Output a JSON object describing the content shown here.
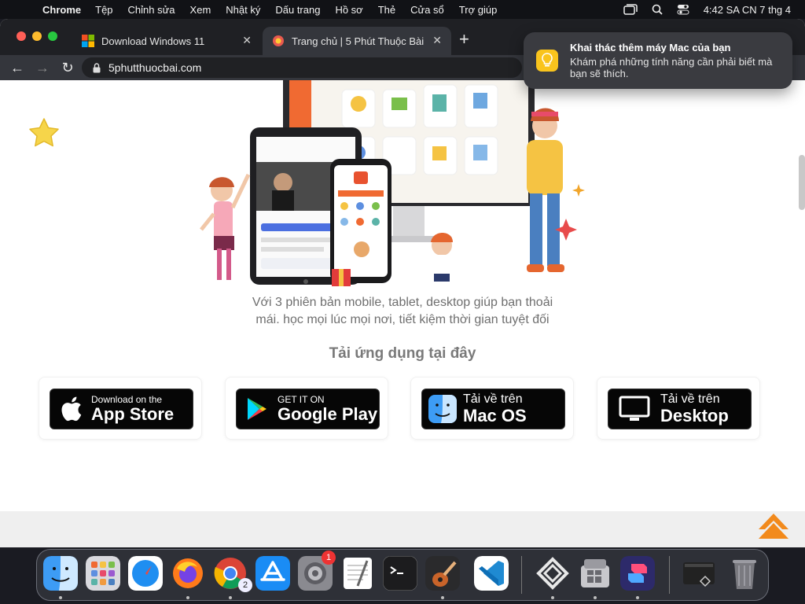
{
  "menubar": {
    "app_name": "Chrome",
    "items": [
      "Tệp",
      "Chỉnh sửa",
      "Xem",
      "Nhật ký",
      "Dấu trang",
      "Hồ sơ",
      "Thẻ",
      "Cửa sổ",
      "Trợ giúp"
    ],
    "clock": "4:42 SA CN 7 thg 4"
  },
  "tabs": [
    {
      "title": "Download Windows 11",
      "active": false
    },
    {
      "title": "Trang chủ | 5 Phút Thuộc Bài",
      "active": true
    }
  ],
  "address_bar": {
    "url": "5phutthuocbai.com"
  },
  "notification": {
    "title": "Khai thác thêm máy Mac của bạn",
    "body": "Khám phá những tính năng cần phải biết mà bạn sẽ thích."
  },
  "page": {
    "tagline_line1": "Với 3 phiên bản mobile, tablet, desktop giúp bạn thoải",
    "tagline_line2": "mái. học mọi lúc mọi nơi, tiết kiệm thời gian tuyệt đối",
    "download_heading": "Tải ứng dụng tại đây",
    "downloads": [
      {
        "small": "Download on the",
        "big": "App Store",
        "icon": "apple-icon"
      },
      {
        "small": "GET IT ON",
        "big": "Google Play",
        "icon": "google-play-icon"
      },
      {
        "small": "Tải về trên",
        "big": "Mac OS",
        "icon": "finder-icon"
      },
      {
        "small": "Tải về trên",
        "big": "Desktop",
        "icon": "monitor-icon"
      }
    ]
  },
  "dock": {
    "apps": [
      "Finder",
      "Launchpad",
      "Safari",
      "Firefox",
      "Chrome",
      "App Store",
      "System Settings",
      "TextEdit",
      "Terminal",
      "GarageBand",
      "Visual Studio Code",
      "Parallels",
      "Boot Camp",
      "Shortcuts",
      "Recent Window",
      "Trash"
    ],
    "chrome_badge": "2",
    "settings_badge": "1"
  },
  "colors": {
    "accent": "#f28a1c",
    "toast_icon": "#f9c41d"
  }
}
